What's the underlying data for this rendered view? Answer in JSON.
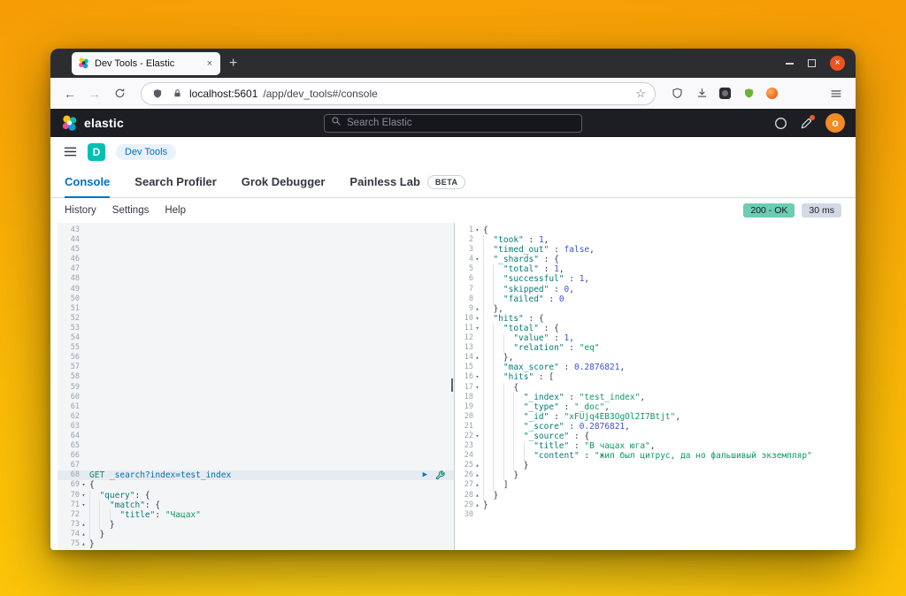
{
  "window": {
    "tab_title": "Dev Tools - Elastic",
    "tab_close": "×",
    "new_tab": "+",
    "close_glyph": "×"
  },
  "browser": {
    "back": "←",
    "forward": "→",
    "url_host": "localhost:5601",
    "url_path": "/app/dev_tools#/console",
    "bookmark_star": "☆"
  },
  "elastic_header": {
    "brand": "elastic",
    "search_placeholder": "Search Elastic",
    "avatar_letter": "o"
  },
  "breadcrumb": {
    "space_initial": "D",
    "crumb": "Dev Tools"
  },
  "tabs": {
    "items": [
      {
        "label": "Console",
        "active": true
      },
      {
        "label": "Search Profiler",
        "active": false
      },
      {
        "label": "Grok Debugger",
        "active": false
      },
      {
        "label": "Painless Lab",
        "active": false,
        "badge": "BETA"
      }
    ]
  },
  "toolbar": {
    "history": "History",
    "settings": "Settings",
    "help": "Help",
    "status_badge": "200 - OK",
    "time_badge": "30 ms"
  },
  "editor_icons": {
    "fold_open": "▾",
    "fold_close": "▴",
    "play": "▶"
  },
  "colors": {
    "accent_blue": "#0071c2",
    "success_badge": "#6dccb1",
    "space_badge": "#00bfb3",
    "avatar_orange": "#f28b22",
    "ubuntu_close": "#e95420"
  },
  "request_editor": {
    "blank_from": 43,
    "blank_to": 67,
    "lines": [
      {
        "n": 68,
        "a": true,
        "t": [
          [
            "GET",
            "method"
          ],
          [
            " ",
            "plain"
          ],
          [
            "_search?index=test_index",
            "url"
          ]
        ]
      },
      {
        "n": 69,
        "f": "s",
        "t": [
          [
            "{",
            "punct"
          ]
        ]
      },
      {
        "n": 70,
        "i": 1,
        "f": "s",
        "t": [
          [
            "\"query\"",
            "key"
          ],
          [
            ": {",
            "punct"
          ]
        ]
      },
      {
        "n": 71,
        "i": 2,
        "f": "s",
        "t": [
          [
            "\"match\"",
            "key"
          ],
          [
            ": {",
            "punct"
          ]
        ]
      },
      {
        "n": 72,
        "i": 3,
        "t": [
          [
            "\"title\"",
            "key"
          ],
          [
            ": ",
            "punct"
          ],
          [
            "\"Чацах\"",
            "str"
          ]
        ]
      },
      {
        "n": 73,
        "i": 2,
        "f": "e",
        "t": [
          [
            "}",
            "punct"
          ]
        ]
      },
      {
        "n": 74,
        "i": 1,
        "f": "e",
        "t": [
          [
            "}",
            "punct"
          ]
        ]
      },
      {
        "n": 75,
        "f": "e",
        "t": [
          [
            "}",
            "punct"
          ]
        ]
      }
    ]
  },
  "response_viewer": {
    "lines": [
      {
        "n": 1,
        "f": "s",
        "t": [
          [
            "{",
            "punct"
          ]
        ]
      },
      {
        "n": 2,
        "i": 1,
        "t": [
          [
            "\"took\"",
            "key"
          ],
          [
            " : ",
            "punct"
          ],
          [
            "1",
            "num"
          ],
          [
            ",",
            "punct"
          ]
        ]
      },
      {
        "n": 3,
        "i": 1,
        "t": [
          [
            "\"timed_out\"",
            "key"
          ],
          [
            " : ",
            "punct"
          ],
          [
            "false",
            "bool"
          ],
          [
            ",",
            "punct"
          ]
        ]
      },
      {
        "n": 4,
        "i": 1,
        "f": "s",
        "t": [
          [
            "\"_shards\"",
            "key"
          ],
          [
            " : ",
            "punct"
          ],
          [
            "{",
            "punct"
          ]
        ]
      },
      {
        "n": 5,
        "i": 2,
        "t": [
          [
            "\"total\"",
            "key"
          ],
          [
            " : ",
            "punct"
          ],
          [
            "1",
            "num"
          ],
          [
            ",",
            "punct"
          ]
        ]
      },
      {
        "n": 6,
        "i": 2,
        "t": [
          [
            "\"successful\"",
            "key"
          ],
          [
            " : ",
            "punct"
          ],
          [
            "1",
            "num"
          ],
          [
            ",",
            "punct"
          ]
        ]
      },
      {
        "n": 7,
        "i": 2,
        "t": [
          [
            "\"skipped\"",
            "key"
          ],
          [
            " : ",
            "punct"
          ],
          [
            "0",
            "num"
          ],
          [
            ",",
            "punct"
          ]
        ]
      },
      {
        "n": 8,
        "i": 2,
        "t": [
          [
            "\"failed\"",
            "key"
          ],
          [
            " : ",
            "punct"
          ],
          [
            "0",
            "num"
          ]
        ]
      },
      {
        "n": 9,
        "i": 1,
        "f": "e",
        "t": [
          [
            "},",
            "punct"
          ]
        ]
      },
      {
        "n": 10,
        "i": 1,
        "f": "s",
        "t": [
          [
            "\"hits\"",
            "key"
          ],
          [
            " : ",
            "punct"
          ],
          [
            "{",
            "punct"
          ]
        ]
      },
      {
        "n": 11,
        "i": 2,
        "f": "s",
        "t": [
          [
            "\"total\"",
            "key"
          ],
          [
            " : ",
            "punct"
          ],
          [
            "{",
            "punct"
          ]
        ]
      },
      {
        "n": 12,
        "i": 3,
        "t": [
          [
            "\"value\"",
            "key"
          ],
          [
            " : ",
            "punct"
          ],
          [
            "1",
            "num"
          ],
          [
            ",",
            "punct"
          ]
        ]
      },
      {
        "n": 13,
        "i": 3,
        "t": [
          [
            "\"relation\"",
            "key"
          ],
          [
            " : ",
            "punct"
          ],
          [
            "\"eq\"",
            "str"
          ]
        ]
      },
      {
        "n": 14,
        "i": 2,
        "f": "e",
        "t": [
          [
            "},",
            "punct"
          ]
        ]
      },
      {
        "n": 15,
        "i": 2,
        "t": [
          [
            "\"max_score\"",
            "key"
          ],
          [
            " : ",
            "punct"
          ],
          [
            "0.2876821",
            "num"
          ],
          [
            ",",
            "punct"
          ]
        ]
      },
      {
        "n": 16,
        "i": 2,
        "f": "s",
        "t": [
          [
            "\"hits\"",
            "key"
          ],
          [
            " : ",
            "punct"
          ],
          [
            "[",
            "punct"
          ]
        ]
      },
      {
        "n": 17,
        "i": 3,
        "f": "s",
        "t": [
          [
            "{",
            "punct"
          ]
        ]
      },
      {
        "n": 18,
        "i": 4,
        "t": [
          [
            "\"_index\"",
            "key"
          ],
          [
            " : ",
            "punct"
          ],
          [
            "\"test_index\"",
            "str"
          ],
          [
            ",",
            "punct"
          ]
        ]
      },
      {
        "n": 19,
        "i": 4,
        "t": [
          [
            "\"_type\"",
            "key"
          ],
          [
            " : ",
            "punct"
          ],
          [
            "\"_doc\"",
            "str"
          ],
          [
            ",",
            "punct"
          ]
        ]
      },
      {
        "n": 20,
        "i": 4,
        "t": [
          [
            "\"_id\"",
            "key"
          ],
          [
            " : ",
            "punct"
          ],
          [
            "\"xFUjq4EB3OgOl2I7Btjt\"",
            "str"
          ],
          [
            ",",
            "punct"
          ]
        ]
      },
      {
        "n": 21,
        "i": 4,
        "t": [
          [
            "\"_score\"",
            "key"
          ],
          [
            " : ",
            "punct"
          ],
          [
            "0.2876821",
            "num"
          ],
          [
            ",",
            "punct"
          ]
        ]
      },
      {
        "n": 22,
        "i": 4,
        "f": "s",
        "t": [
          [
            "\"_source\"",
            "key"
          ],
          [
            " : ",
            "punct"
          ],
          [
            "{",
            "punct"
          ]
        ]
      },
      {
        "n": 23,
        "i": 5,
        "t": [
          [
            "\"title\"",
            "key"
          ],
          [
            " : ",
            "punct"
          ],
          [
            "\"В чацах юга\"",
            "str"
          ],
          [
            ",",
            "punct"
          ]
        ]
      },
      {
        "n": 24,
        "i": 5,
        "t": [
          [
            "\"content\"",
            "key"
          ],
          [
            " : ",
            "punct"
          ],
          [
            "\"жил был цитрус, да но фальшивый экземпляр\"",
            "str"
          ]
        ]
      },
      {
        "n": 25,
        "i": 4,
        "f": "e",
        "t": [
          [
            "}",
            "punct"
          ]
        ]
      },
      {
        "n": 26,
        "i": 3,
        "f": "e",
        "t": [
          [
            "}",
            "punct"
          ]
        ]
      },
      {
        "n": 27,
        "i": 2,
        "f": "e",
        "t": [
          [
            "]",
            "punct"
          ]
        ]
      },
      {
        "n": 28,
        "i": 1,
        "f": "e",
        "t": [
          [
            "}",
            "punct"
          ]
        ]
      },
      {
        "n": 29,
        "f": "e",
        "t": [
          [
            "}",
            "punct"
          ]
        ]
      },
      {
        "n": 30,
        "t": []
      }
    ]
  }
}
